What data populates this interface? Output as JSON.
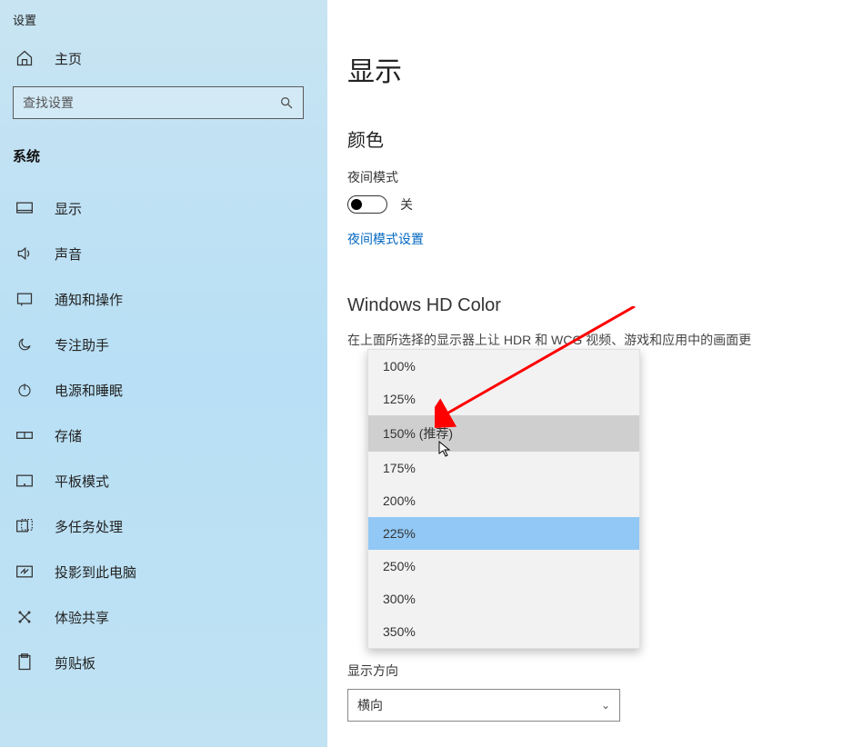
{
  "sidebar": {
    "title": "设置",
    "home": "主页",
    "search_placeholder": "查找设置",
    "section": "系统",
    "items": [
      {
        "label": "显示"
      },
      {
        "label": "声音"
      },
      {
        "label": "通知和操作"
      },
      {
        "label": "专注助手"
      },
      {
        "label": "电源和睡眠"
      },
      {
        "label": "存储"
      },
      {
        "label": "平板模式"
      },
      {
        "label": "多任务处理"
      },
      {
        "label": "投影到此电脑"
      },
      {
        "label": "体验共享"
      },
      {
        "label": "剪贴板"
      }
    ]
  },
  "main": {
    "title": "显示",
    "color_h": "颜色",
    "night_label": "夜间模式",
    "night_state": "关",
    "night_link": "夜间模式设置",
    "hd_h": "Windows HD Color",
    "hd_desc": "在上面所选择的显示器上让 HDR 和 WCG 视频、游戏和应用中的画面更",
    "scale_options": [
      "100%",
      "125%",
      "150% (推荐)",
      "175%",
      "200%",
      "225%",
      "250%",
      "300%",
      "350%"
    ],
    "orientation_label": "显示方向",
    "orientation_value": "横向"
  }
}
